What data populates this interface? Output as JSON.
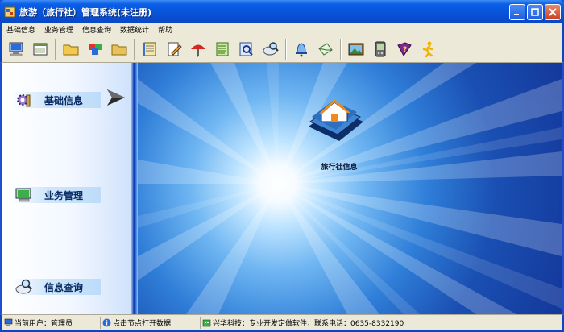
{
  "window": {
    "title": "旅游（旅行社）管理系统(未注册)",
    "controls": {
      "minimize": "minimize-icon",
      "maximize": "maximize-icon",
      "close": "close-icon"
    }
  },
  "menu": {
    "items": [
      {
        "label": "基础信息"
      },
      {
        "label": "业务管理"
      },
      {
        "label": "信息查询"
      },
      {
        "label": "数据统计"
      },
      {
        "label": "帮助"
      }
    ]
  },
  "toolbar": {
    "buttons": [
      {
        "icon": "computer-icon"
      },
      {
        "icon": "window-icon"
      },
      {
        "icon": "folder-icon"
      },
      {
        "icon": "multi-color-folder-icon"
      },
      {
        "icon": "yellow-folder-icon"
      },
      {
        "icon": "notebook-icon"
      },
      {
        "icon": "edit-document-icon"
      },
      {
        "icon": "umbrella-icon"
      },
      {
        "icon": "notepad-icon"
      },
      {
        "icon": "search-document-icon"
      },
      {
        "icon": "magnifier-plate-icon"
      },
      {
        "icon": "bell-icon"
      },
      {
        "icon": "envelope-icon"
      },
      {
        "icon": "picture-icon"
      },
      {
        "icon": "pda-icon"
      },
      {
        "icon": "help-book-icon"
      },
      {
        "icon": "running-man-icon"
      }
    ]
  },
  "sidebar": {
    "items": [
      {
        "label": "基础信息",
        "icon": "gears-icon"
      },
      {
        "label": "业务管理",
        "icon": "monitor-icon"
      },
      {
        "label": "信息查询",
        "icon": "magnifier-plate-icon"
      }
    ]
  },
  "content": {
    "item_label": "旅行社信息",
    "item_icon": "house-book-icon"
  },
  "status": {
    "user": "当前用户：管理员",
    "hint": "点击节点打开数据",
    "company": "兴华科技：专业开发定做软件，联系电话：0635-8332190"
  },
  "colors": {
    "title_blue": "#0852d8",
    "chrome": "#ece9d8",
    "accent_light": "#bde3ff"
  }
}
